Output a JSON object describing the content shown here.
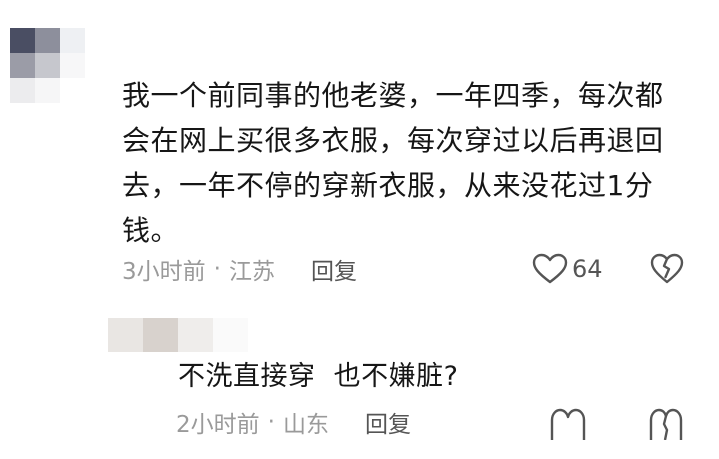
{
  "comments": [
    {
      "text": "我一个前同事的他老婆，一年四季，每次都会在网上买很多衣服，每次穿过以后再退回去，一年不停的穿新衣服，从来没花过1分钱。",
      "time": "3小时前",
      "separator": "·",
      "location": "江苏",
      "reply_label": "回复",
      "like_count": "64",
      "like_icon": "heart-outline-icon",
      "dislike_icon": "broken-heart-icon"
    },
    {
      "text": "不洗直接穿  也不嫌脏?",
      "time": "2小时前",
      "separator": "·",
      "location": "山东",
      "reply_label": "回复",
      "like_icon": "heart-outline-icon",
      "dislike_icon": "broken-heart-icon"
    }
  ],
  "colors": {
    "text": "#161616",
    "meta": "#9a9a9a",
    "action": "#555555",
    "background": "#ffffff"
  }
}
